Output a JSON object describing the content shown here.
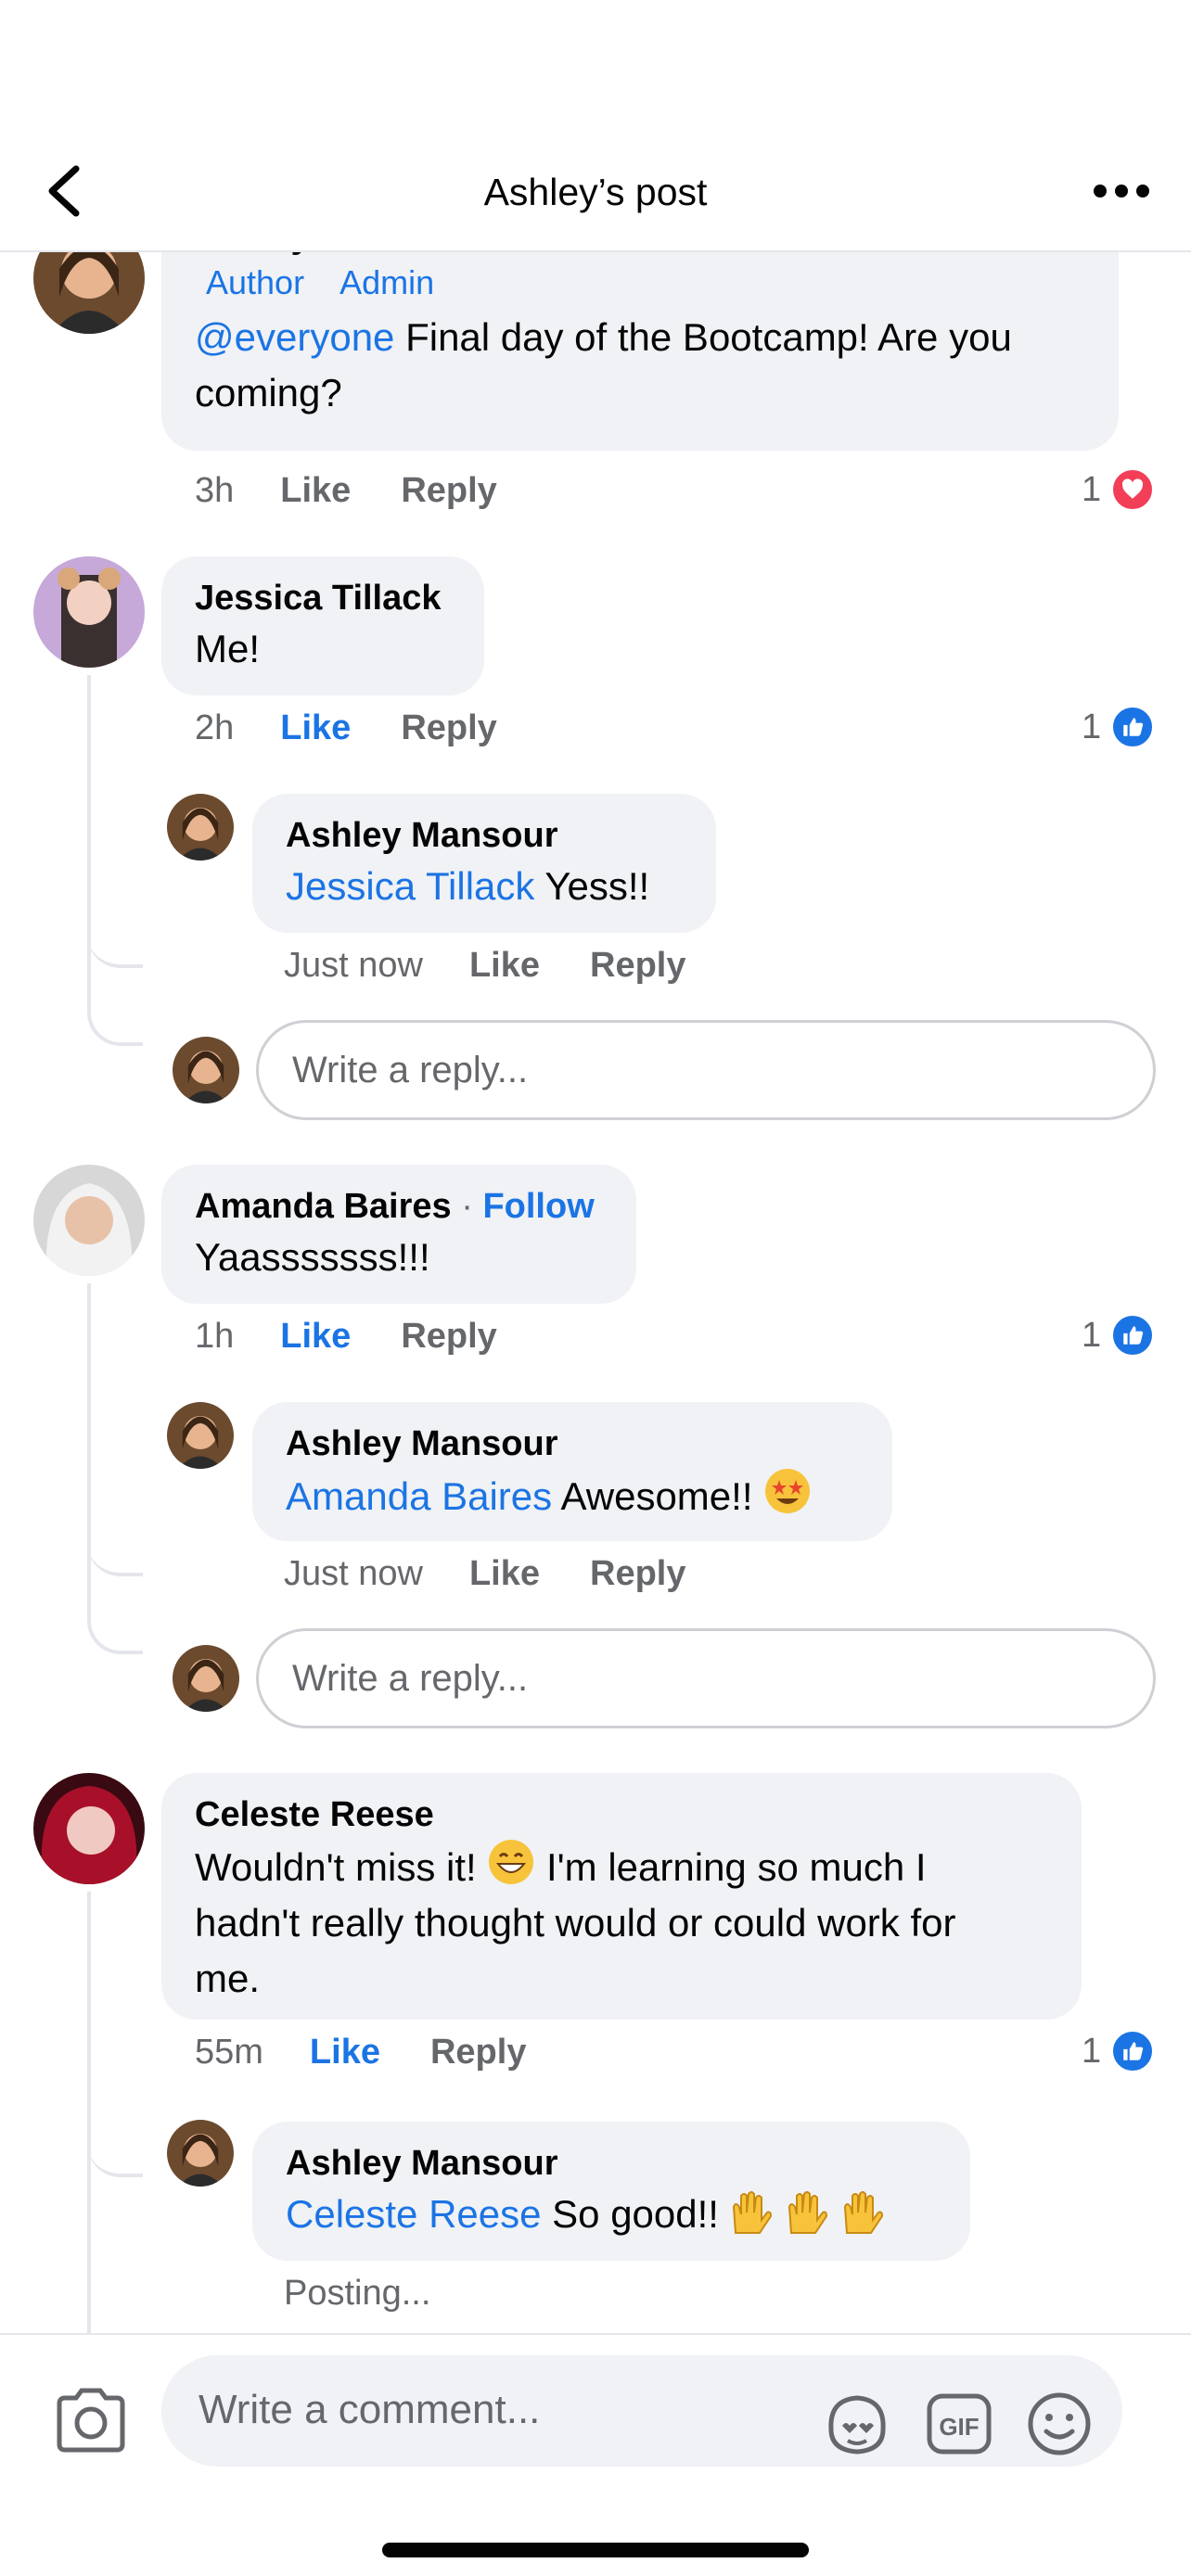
{
  "header": {
    "title": "Ashley’s post",
    "back_icon": "chevron-left-icon",
    "more_icon": "more-horizontal-icon"
  },
  "comments": [
    {
      "author": "Ashley Mansour",
      "badges": [
        "Author",
        "Admin"
      ],
      "mention": "@everyone",
      "text_line1": " Final day of the Bootcamp! Are you",
      "text_line2": "coming?",
      "time": "3h",
      "like_label": "Like",
      "reply_label": "Reply",
      "reaction_count": "1",
      "reaction_icon": "heart-icon"
    },
    {
      "author": "Jessica Tillack",
      "text": "Me!",
      "time": "2h",
      "like_label": "Like",
      "reply_label": "Reply",
      "reaction_count": "1",
      "reaction_icon": "thumbs-up-icon",
      "reply": {
        "author": "Ashley Mansour",
        "mention": "Jessica Tillack",
        "text": " Yess!!",
        "time": "Just now",
        "like_label": "Like",
        "reply_label": "Reply"
      },
      "reply_placeholder": "Write a reply..."
    },
    {
      "author": "Amanda Baires",
      "separator": " · ",
      "follow_label": "Follow",
      "text": "Yaasssssss!!!",
      "time": "1h",
      "like_label": "Like",
      "reply_label": "Reply",
      "reaction_count": "1",
      "reaction_icon": "thumbs-up-icon",
      "reply": {
        "author": "Ashley Mansour",
        "mention": "Amanda Baires",
        "text": " Awesome!! ",
        "emoji": "star-struck-emoji",
        "time": "Just now",
        "like_label": "Like",
        "reply_label": "Reply"
      },
      "reply_placeholder": "Write a reply..."
    },
    {
      "author": "Celeste Reese",
      "text_part1": "Wouldn't miss it! ",
      "emoji": "grinning-emoji",
      "text_part2": " I'm learning so much I",
      "text_line2": "hadn't really thought would or could work for",
      "text_line3": "me.",
      "time": "55m",
      "like_label": "Like",
      "reply_label": "Reply",
      "reaction_count": "1",
      "reaction_icon": "thumbs-up-icon",
      "reply": {
        "author": "Ashley Mansour",
        "mention": "Celeste Reese",
        "text": " So good!! ",
        "emoji": "raising-hands-emoji",
        "status": "Posting..."
      }
    }
  ],
  "composer": {
    "placeholder": "Write a comment...",
    "camera_icon": "camera-icon",
    "avatar_sticker_icon": "avatar-sticker-icon",
    "gif_icon": "gif-icon",
    "emoji_icon": "smiley-icon"
  },
  "colors": {
    "accent": "#1b74e4",
    "bubble": "#f0f2f5",
    "muted": "#65676b",
    "heart": "#f33e58"
  }
}
